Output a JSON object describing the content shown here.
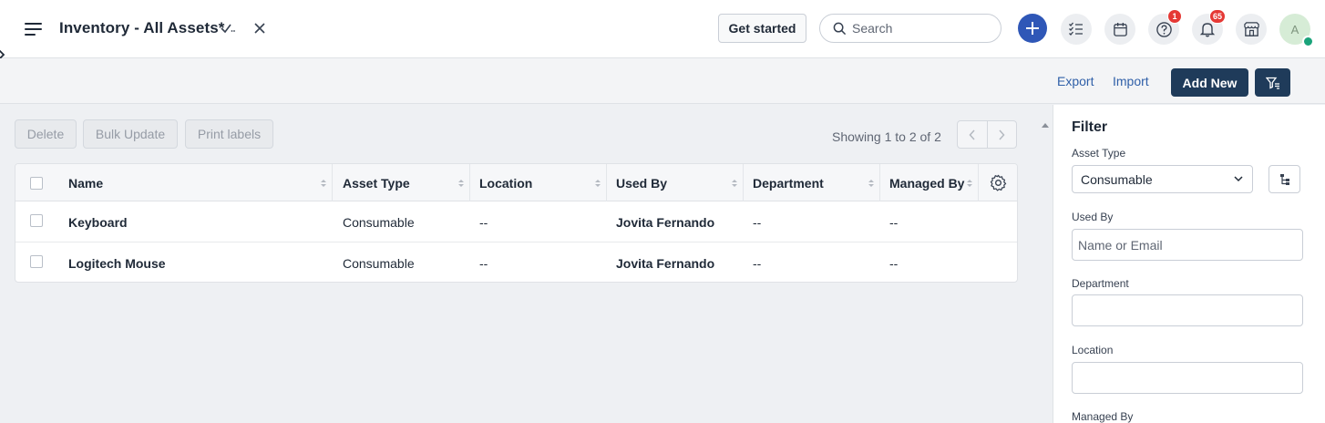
{
  "header": {
    "title": "Inventory - All Assets*",
    "get_started_label": "Get started",
    "search_placeholder": "Search",
    "help_badge": "1",
    "notifications_badge": "65",
    "avatar_initial": "A"
  },
  "actions": {
    "export_label": "Export",
    "import_label": "Import",
    "add_new_label": "Add New"
  },
  "toolbar": {
    "delete_label": "Delete",
    "bulk_update_label": "Bulk Update",
    "print_labels_label": "Print labels",
    "showing_text": "Showing 1 to 2 of 2"
  },
  "table": {
    "columns": [
      "Name",
      "Asset Type",
      "Location",
      "Used By",
      "Department",
      "Managed By"
    ],
    "rows": [
      {
        "name": "Keyboard",
        "asset_type": "Consumable",
        "location": "--",
        "used_by": "Jovita Fernando",
        "department": "--",
        "managed_by": "--"
      },
      {
        "name": "Logitech Mouse",
        "asset_type": "Consumable",
        "location": "--",
        "used_by": "Jovita Fernando",
        "department": "--",
        "managed_by": "--"
      }
    ]
  },
  "filter": {
    "title": "Filter",
    "asset_type_label": "Asset Type",
    "asset_type_value": "Consumable",
    "used_by_label": "Used By",
    "used_by_placeholder": "Name or Email",
    "department_label": "Department",
    "location_label": "Location",
    "managed_by_label": "Managed By"
  },
  "colors": {
    "primary_dark": "#1f3b5a",
    "accent_blue": "#2f57b7",
    "link_blue": "#2f5fa8",
    "badge_red": "#e53935",
    "status_green": "#1aa37a"
  }
}
